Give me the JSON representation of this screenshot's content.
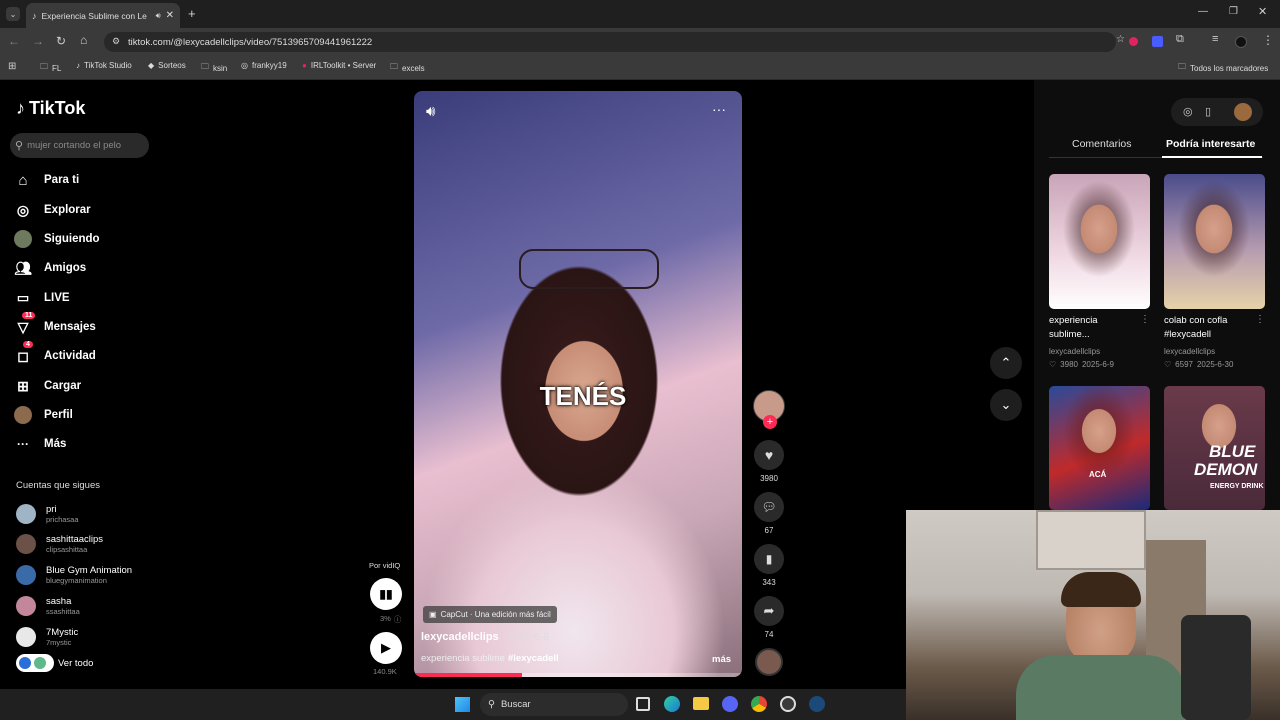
{
  "browser": {
    "tab_title": "Experiencia Sublime con Le",
    "url": "tiktok.com/@lexycadellclips/video/7513965709441961222",
    "bookmarks": [
      "FL",
      "TikTok Studio",
      "Sorteos",
      "ksin",
      "frankyy19",
      "IRLToolkit • Server",
      "excels"
    ],
    "all_bookmarks": "Todos los marcadores"
  },
  "sidebar": {
    "logo": "TikTok",
    "search_placeholder": "mujer cortando el pelo",
    "nav": [
      {
        "label": "Para ti",
        "icon": "home-icon"
      },
      {
        "label": "Explorar",
        "icon": "compass-icon"
      },
      {
        "label": "Siguiendo",
        "icon": "following-icon"
      },
      {
        "label": "Amigos",
        "icon": "friends-icon"
      },
      {
        "label": "LIVE",
        "icon": "live-icon"
      },
      {
        "label": "Mensajes",
        "icon": "messages-icon",
        "badge": "11"
      },
      {
        "label": "Actividad",
        "icon": "activity-icon",
        "badge": "4"
      },
      {
        "label": "Cargar",
        "icon": "upload-icon"
      },
      {
        "label": "Perfil",
        "icon": "profile-icon"
      },
      {
        "label": "Más",
        "icon": "more-icon"
      }
    ],
    "following_title": "Cuentas que sigues",
    "accounts": [
      {
        "name": "pri",
        "handle": "prichasaa"
      },
      {
        "name": "sashittaaclips",
        "handle": "clipsashittaa"
      },
      {
        "name": "Blue Gym Animation",
        "handle": "bluegymanimation"
      },
      {
        "name": "sasha",
        "handle": "ssashittaa"
      },
      {
        "name": "7Mystic",
        "handle": "7mystic"
      }
    ],
    "see_all": "Ver todo"
  },
  "player": {
    "caption_overlay": "TENÉS",
    "capcut": "CapCut · Una edición más fácil",
    "author": "lexycadellclips",
    "date": "· 2025-6-9",
    "description": "experiencia sublime",
    "hashtag": "#lexycadell",
    "more": "más",
    "progress": 0.33,
    "likes": "3980",
    "comments": "67",
    "saves": "343",
    "shares": "74",
    "vidiq_label": "Por vidIQ",
    "vidiq_pct": "3%",
    "vidiq_views": "140.9K"
  },
  "right_panel": {
    "tabs": [
      "Comentarios",
      "Podría interesarte"
    ],
    "active_tab": 1,
    "cards": [
      {
        "title1": "experiencia",
        "title2": "sublime...",
        "author": "lexycadellclips",
        "likes": "3980",
        "date": "2025-6-9"
      },
      {
        "title1": "colab con cofla",
        "title2": "#lexycadell",
        "author": "lexycadellclips",
        "likes": "6597",
        "date": "2025-6-30"
      }
    ],
    "card3_caption": "ACÁ",
    "card4_brand": "BLUE",
    "card4_brand2": "DEMON",
    "card4_sub": "ENERGY DRINK"
  },
  "taskbar": {
    "search": "Buscar"
  },
  "colors": {
    "accent": "#fe2c55",
    "bg": "#000000",
    "chrome": "#3a3a3a"
  }
}
